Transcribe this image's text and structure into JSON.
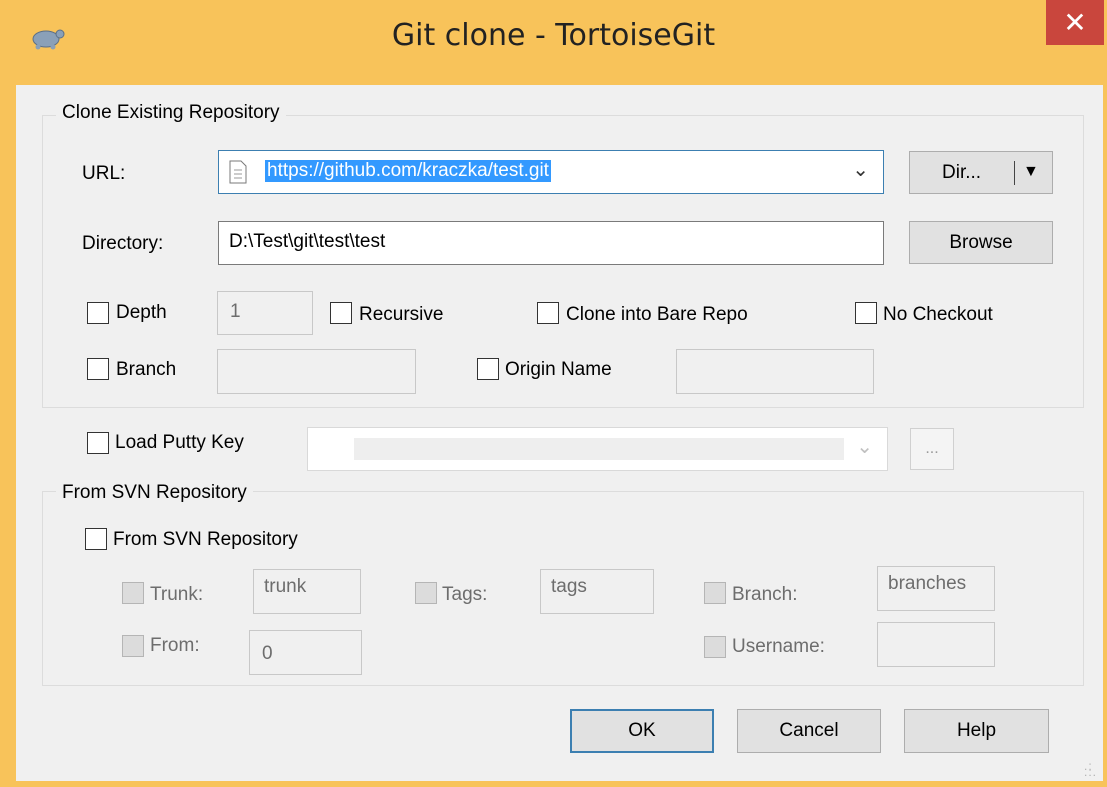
{
  "window": {
    "title": "Git clone - TortoiseGit",
    "close_glyph": "✕",
    "accent_color": "#f8c35a",
    "close_color": "#c9463d"
  },
  "clone_group": {
    "title": "Clone Existing Repository",
    "url_label": "URL:",
    "url_value": "https://github.com/kraczka/test.git",
    "dir_button_label": "Dir...",
    "directory_label": "Directory:",
    "directory_value": "D:\\Test\\git\\test\\test",
    "browse_label": "Browse",
    "depth_label": "Depth",
    "depth_value": "1",
    "recursive_label": "Recursive",
    "bare_label": "Clone into Bare Repo",
    "no_checkout_label": "No Checkout",
    "branch_label": "Branch",
    "branch_value": "",
    "origin_label": "Origin Name",
    "origin_value": ""
  },
  "putty": {
    "label": "Load Putty Key",
    "value": "",
    "ellipsis_label": "..."
  },
  "svn_group": {
    "title": "From SVN Repository",
    "from_svn_label": "From SVN Repository",
    "trunk_label": "Trunk:",
    "trunk_value": "trunk",
    "tags_label": "Tags:",
    "tags_value": "tags",
    "branch_label": "Branch:",
    "branch_value": "branches",
    "from_label": "From:",
    "from_value": "0",
    "username_label": "Username:",
    "username_value": ""
  },
  "footer": {
    "ok_label": "OK",
    "cancel_label": "Cancel",
    "help_label": "Help"
  }
}
